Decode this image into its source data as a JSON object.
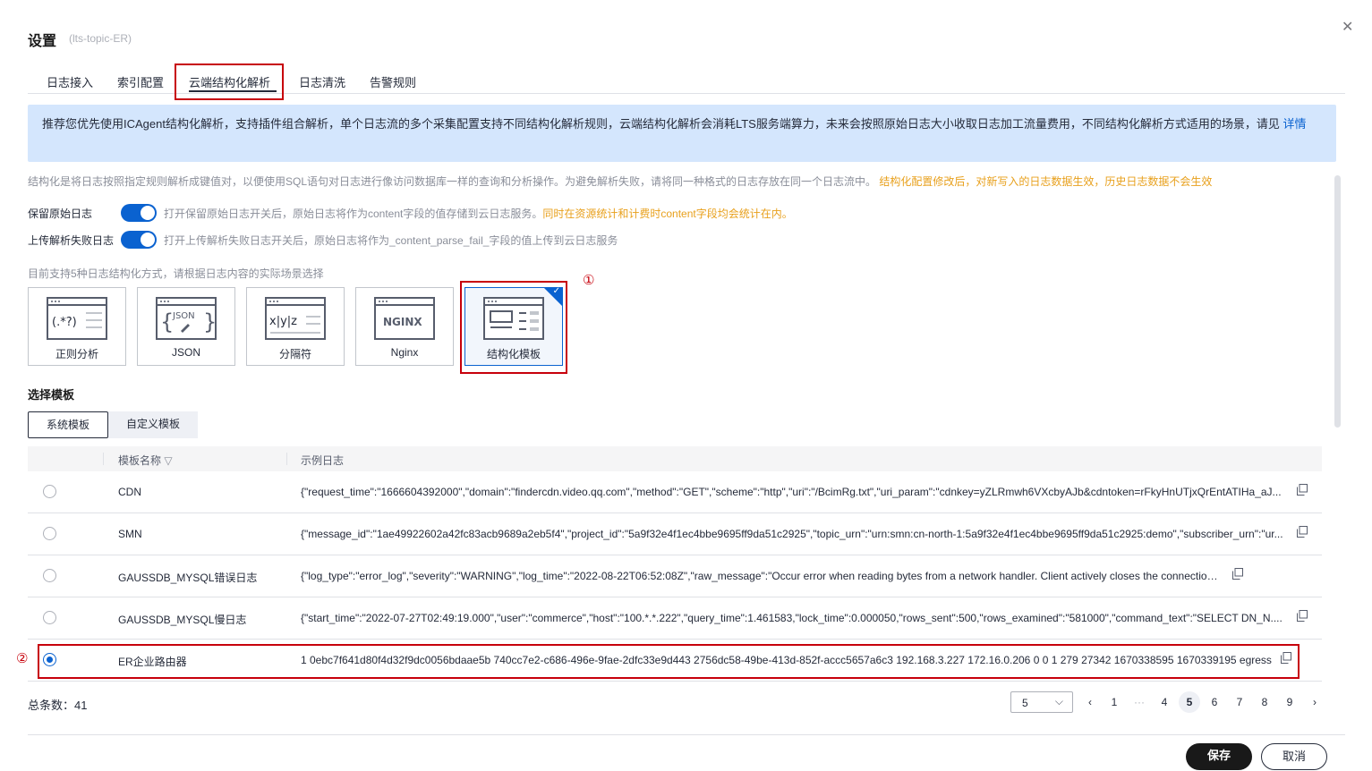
{
  "header": {
    "title": "设置",
    "subtitle": "(lts-topic-ER)"
  },
  "tabs": [
    {
      "label": "日志接入"
    },
    {
      "label": "索引配置"
    },
    {
      "label": "云端结构化解析"
    },
    {
      "label": "日志清洗"
    },
    {
      "label": "告警规则"
    }
  ],
  "banner": {
    "text": "推荐您优先使用ICAgent结构化解析，支持插件组合解析，单个日志流的多个采集配置支持不同结构化解析规则，云端结构化解析会消耗LTS服务端算力，未来会按照原始日志大小收取日志加工流量费用，不同结构化解析方式适用的场景，请见",
    "link": "详情"
  },
  "description": {
    "text": "结构化是将日志按照指定规则解析成键值对，以便使用SQL语句对日志进行像访问数据库一样的查询和分析操作。为避免解析失败，请将同一种格式的日志存放在同一个日志流中。",
    "warning": "结构化配置修改后，对新写入的日志数据生效，历史日志数据不会生效"
  },
  "toggles": [
    {
      "label": "保留原始日志",
      "desc": "打开保留原始日志开关后，原始日志将作为content字段的值存储到云日志服务。",
      "warning": "同时在资源统计和计费时content字段均会统计在内。"
    },
    {
      "label": "上传解析失败日志",
      "desc": "打开上传解析失败日志开关后，原始日志将作为_content_parse_fail_字段的值上传到云日志服务",
      "warning": ""
    }
  ],
  "methods": {
    "hint": "目前支持5种日志结构化方式，请根据日志内容的实际场景选择",
    "items": [
      {
        "label": "正则分析",
        "icon_text": "(.*?)"
      },
      {
        "label": "JSON",
        "icon_text": "JSON"
      },
      {
        "label": "分隔符",
        "icon_text": "x|y|z"
      },
      {
        "label": "Nginx",
        "icon_text": "NGINX"
      },
      {
        "label": "结构化模板",
        "icon_text": ""
      }
    ],
    "selected_index": 4
  },
  "markers": {
    "one": "①",
    "two": "②"
  },
  "template_section": {
    "title": "选择模板",
    "seg": [
      "系统模板",
      "自定义模板"
    ],
    "columns": [
      "模板名称",
      "示例日志"
    ],
    "rows": [
      {
        "name": "CDN",
        "sample": "{\"request_time\":\"1666604392000\",\"domain\":\"findercdn.video.qq.com\",\"method\":\"GET\",\"scheme\":\"http\",\"uri\":\"/BcimRg.txt\",\"uri_param\":\"cdnkey=yZLRmwh6VXcbyAJb&cdntoken=rFkyHnUTjxQrEntATIHa_aJ...",
        "checked": false
      },
      {
        "name": "SMN",
        "sample": "{\"message_id\":\"1ae49922602a42fc83acb9689a2eb5f4\",\"project_id\":\"5a9f32e4f1ec4bbe9695ff9da51c2925\",\"topic_urn\":\"urn:smn:cn-north-1:5a9f32e4f1ec4bbe9695ff9da51c2925:demo\",\"subscriber_urn\":\"ur...",
        "checked": false
      },
      {
        "name": "GAUSSDB_MYSQL错误日志",
        "sample": "{\"log_type\":\"error_log\",\"severity\":\"WARNING\",\"log_time\":\"2022-08-22T06:52:08Z\",\"raw_message\":\"Occur error when reading bytes from a network handler. Client actively closes the connection.\"}",
        "checked": false
      },
      {
        "name": "GAUSSDB_MYSQL慢日志",
        "sample": "{\"start_time\":\"2022-07-27T02:49:19.000\",\"user\":\"commerce\",\"host\":\"100.*.*.222\",\"query_time\":1.461583,\"lock_time\":0.000050,\"rows_sent\":500,\"rows_examined\":\"581000\",\"command_text\":\"SELECT DN_N....",
        "checked": false
      },
      {
        "name": "ER企业路由器",
        "sample": "1 0ebc7f641d80f4d32f9dc0056bdaae5b 740cc7e2-c686-496e-9fae-2dfc33e9d443 2756dc58-49be-413d-852f-accc5657a6c3 192.168.3.227 172.16.0.206 0 0 1 279 27342 1670338595 1670339195 egress",
        "checked": true
      }
    ]
  },
  "pagination": {
    "total_label": "总条数：41",
    "page_size": "5",
    "pages": [
      "1",
      "···",
      "4",
      "5",
      "6",
      "7",
      "8",
      "9"
    ],
    "current": "5"
  },
  "footer": {
    "save": "保存",
    "cancel": "取消"
  },
  "colors": {
    "accent": "#0a62d0",
    "highlight": "#c7000b",
    "warning": "#e8a01c"
  }
}
